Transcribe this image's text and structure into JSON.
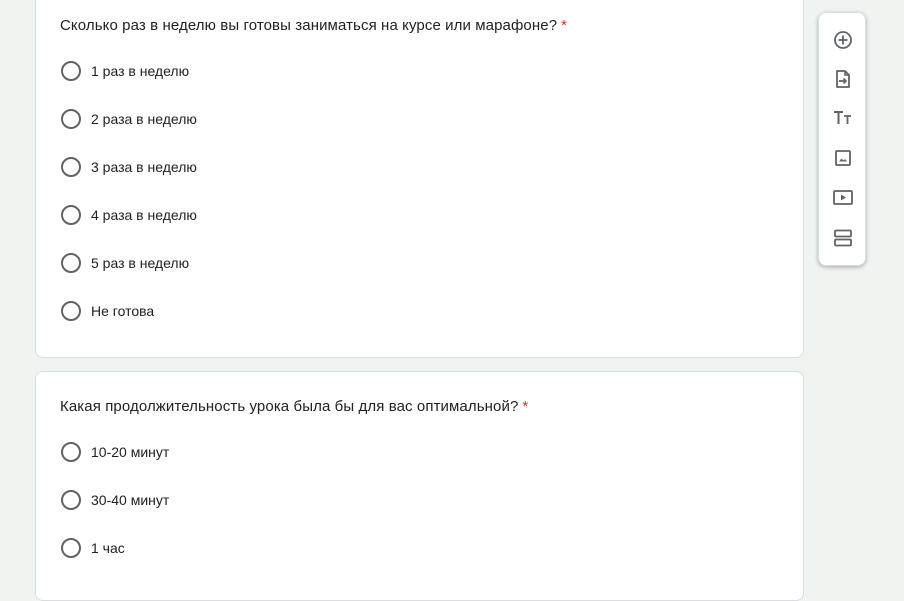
{
  "questions": [
    {
      "title": "Сколько раз в неделю вы готовы заниматься на курсе или марафоне?",
      "required_mark": "*",
      "options": [
        {
          "label": "1 раз в неделю"
        },
        {
          "label": "2 раза в неделю"
        },
        {
          "label": "3 раза в неделю"
        },
        {
          "label": "4 раза в неделю"
        },
        {
          "label": "5 раз в неделю"
        },
        {
          "label": "Не готова"
        }
      ]
    },
    {
      "title": "Какая продолжительность урока была бы для вас оптимальной?",
      "required_mark": "*",
      "options": [
        {
          "label": "10-20 минут"
        },
        {
          "label": "30-40 минут"
        },
        {
          "label": "1 час"
        }
      ]
    }
  ],
  "toolbar": {
    "tools": [
      {
        "icon": "add-question-icon"
      },
      {
        "icon": "import-questions-icon"
      },
      {
        "icon": "title-text-icon"
      },
      {
        "icon": "image-icon"
      },
      {
        "icon": "video-icon"
      },
      {
        "icon": "section-icon"
      }
    ]
  },
  "colors": {
    "background": "#f0f4f1",
    "required": "#d93025",
    "radio_border": "#5f6368",
    "text": "#202124",
    "icon": "#5f6368"
  }
}
